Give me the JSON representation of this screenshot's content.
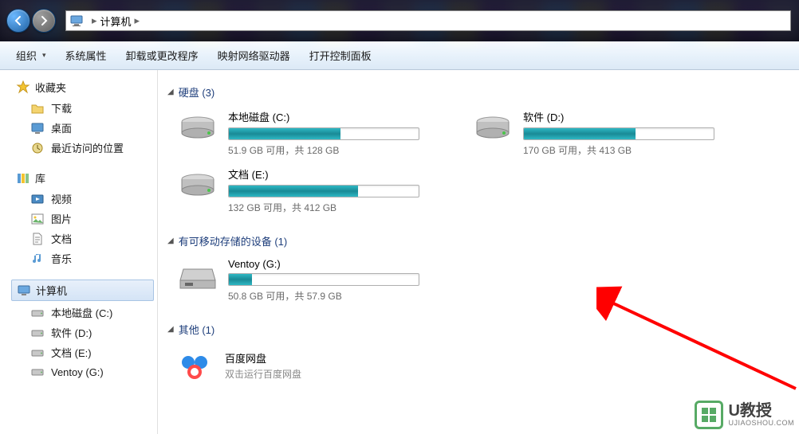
{
  "titlebar": {
    "address_icon": "computer-icon",
    "address_text": "计算机",
    "address_sep": "▸"
  },
  "toolbar": {
    "organize": "组织",
    "sys_props": "系统属性",
    "uninstall": "卸载或更改程序",
    "map_drive": "映射网络驱动器",
    "control_panel": "打开控制面板"
  },
  "sidebar": {
    "favorites": {
      "label": "收藏夹",
      "items": [
        "下载",
        "桌面",
        "最近访问的位置"
      ]
    },
    "libraries": {
      "label": "库",
      "items": [
        "视频",
        "图片",
        "文档",
        "音乐"
      ]
    },
    "computer": {
      "label": "计算机",
      "items": [
        "本地磁盘 (C:)",
        "软件 (D:)",
        "文档 (E:)",
        "Ventoy (G:)"
      ]
    }
  },
  "content": {
    "sections": {
      "hdd": {
        "title": "硬盘 (3)",
        "drives": [
          {
            "name": "本地磁盘 (C:)",
            "stats": "51.9 GB 可用，共 128 GB",
            "fill_pct": 59
          },
          {
            "name": "软件 (D:)",
            "stats": "170 GB 可用，共 413 GB",
            "fill_pct": 59
          },
          {
            "name": "文档 (E:)",
            "stats": "132 GB 可用，共 412 GB",
            "fill_pct": 68
          }
        ]
      },
      "removable": {
        "title": "有可移动存储的设备 (1)",
        "drives": [
          {
            "name": "Ventoy (G:)",
            "stats": "50.8 GB 可用，共 57.9 GB",
            "fill_pct": 12
          }
        ]
      },
      "other": {
        "title": "其他 (1)",
        "items": [
          {
            "name": "百度网盘",
            "desc": "双击运行百度网盘"
          }
        ]
      }
    }
  },
  "watermark": {
    "brand": "U教授",
    "url": "UJIAOSHOU.COM"
  },
  "colors": {
    "accent": "#1e3e7b",
    "bar_fill": "#2eb8c4",
    "arrow": "#ff0000"
  }
}
